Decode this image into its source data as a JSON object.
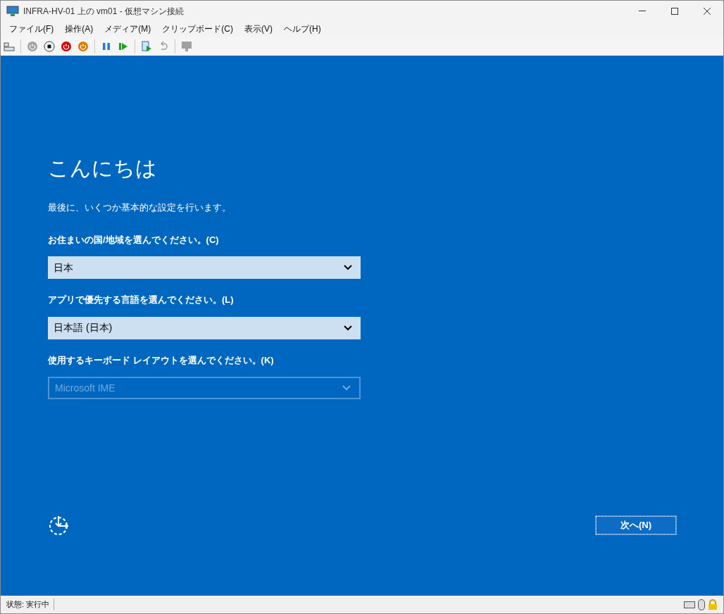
{
  "window": {
    "title": "INFRA-HV-01 上の vm01  - 仮想マシン接続"
  },
  "menu": [
    "ファイル(F)",
    "操作(A)",
    "メディア(M)",
    "クリップボード(C)",
    "表示(V)",
    "ヘルプ(H)"
  ],
  "toolbar": [
    {
      "kind": "ctrl-alt-del",
      "disabled": false
    },
    {
      "kind": "separator"
    },
    {
      "kind": "start",
      "disabled": true
    },
    {
      "kind": "turn-off",
      "disabled": false
    },
    {
      "kind": "shutdown",
      "disabled": false
    },
    {
      "kind": "save",
      "disabled": false
    },
    {
      "kind": "separator"
    },
    {
      "kind": "pause",
      "disabled": false
    },
    {
      "kind": "resume",
      "disabled": false
    },
    {
      "kind": "separator"
    },
    {
      "kind": "checkpoint",
      "disabled": false
    },
    {
      "kind": "revert",
      "disabled": true
    },
    {
      "kind": "separator"
    },
    {
      "kind": "enhanced",
      "disabled": true
    }
  ],
  "setup": {
    "heading": "こんにちは",
    "intro": "最後に、いくつか基本的な設定を行います。",
    "fields": [
      {
        "label": "お住まいの国/地域を選んでください。(C)",
        "value": "日本",
        "disabled": false
      },
      {
        "label": "アプリで優先する言語を選んでください。(L)",
        "value": "日本語 (日本)",
        "disabled": false
      },
      {
        "label": "使用するキーボード レイアウトを選んでください。(K)",
        "value": "Microsoft IME",
        "disabled": true
      }
    ],
    "next_button": "次へ(N)"
  },
  "status_bar": {
    "status": "状態: 実行中"
  }
}
